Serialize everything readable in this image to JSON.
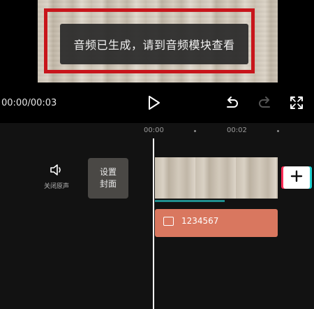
{
  "toast": {
    "message": "音频已生成，请到音频模块查看"
  },
  "player": {
    "timecode": "00:00/00:03",
    "icons": [
      "play-icon",
      "undo-icon",
      "redo-icon",
      "fullscreen-icon"
    ]
  },
  "timeline": {
    "ruler": {
      "labels": [
        "00:00",
        "00:02"
      ]
    },
    "mute": {
      "label": "关闭原声",
      "icon": "speaker-icon"
    },
    "cover": {
      "line1": "设置",
      "line2": "封面"
    },
    "text_track": {
      "label": "1234567",
      "icon": "text-icon"
    },
    "add_icon": "plus-icon"
  },
  "colors": {
    "highlight_box": "#c8151b",
    "text_track": "#d9775f",
    "video_track_bar": "#1f8f8f"
  }
}
